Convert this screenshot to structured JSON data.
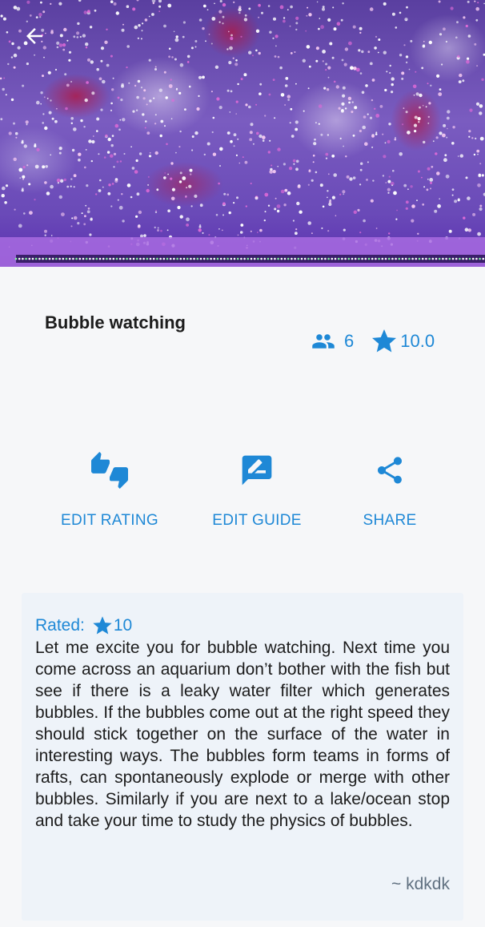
{
  "header": {
    "image_alt": "bubble wall aquarium lit purple",
    "back_icon": "arrow-left-icon"
  },
  "activity": {
    "title": "Bubble watching",
    "participants": "6",
    "rating": "10.0"
  },
  "actions": [
    {
      "label": "EDIT RATING",
      "icon": "thumbs-up-down-icon"
    },
    {
      "label": "EDIT GUIDE",
      "icon": "rate-review-icon"
    },
    {
      "label": "SHARE",
      "icon": "share-icon"
    }
  ],
  "review": {
    "rated_label": "Rated:",
    "rated_value": "10",
    "text": "Let me excite you for bubble watching. Next time you come across an aquarium don’t bother with the fish but see if there is a leaky water filter which generates bubbles. If the bubbles come out at the right speed they should stick together on the surface of the water in interesting ways. The bubbles form teams in forms of rafts, can spontaneously explode or merge with other bubbles. Similarly if you are next to a lake/ocean stop and take your time to study the physics of bubbles.",
    "author": "~ kdkdk"
  },
  "colors": {
    "accent": "#1e88d6",
    "background": "#f6f7f9",
    "card": "#eef3f9"
  }
}
